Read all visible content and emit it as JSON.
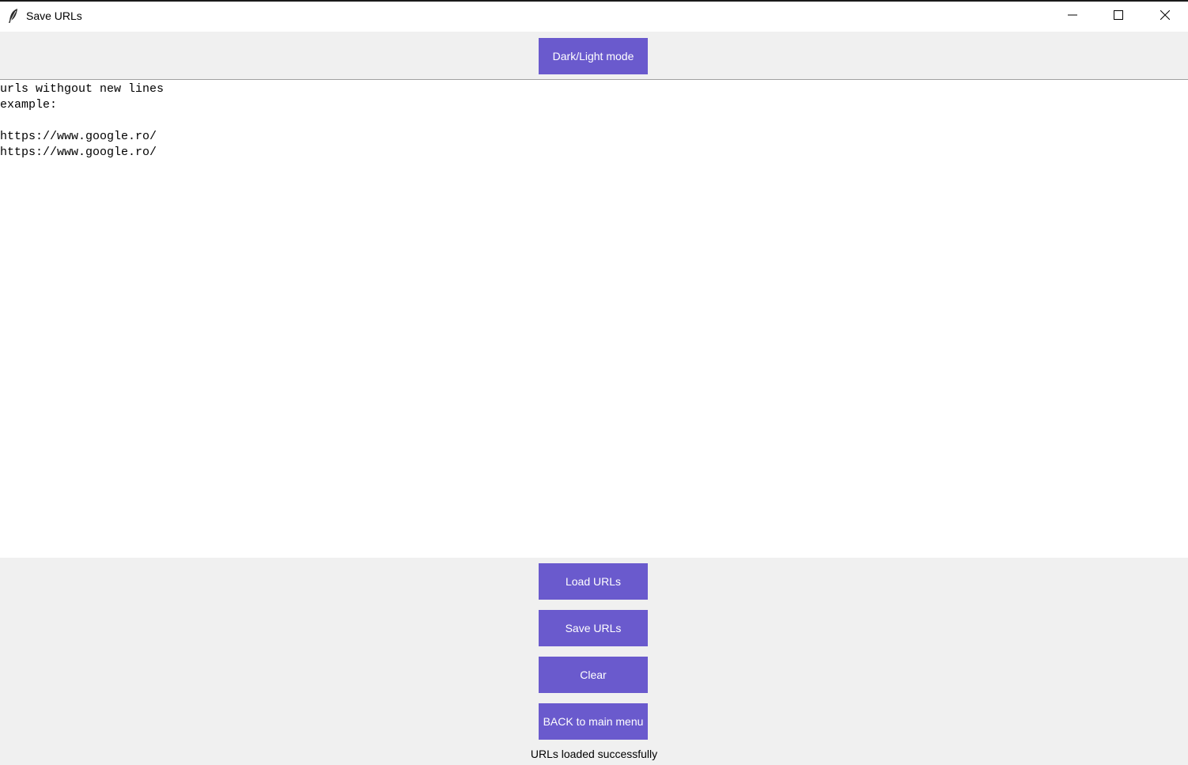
{
  "window": {
    "title": "Save URLs",
    "icon": "feather-icon"
  },
  "toolbar": {
    "mode_label": "Dark/Light mode"
  },
  "editor": {
    "content": "urls withgout new lines\nexample:\n\nhttps://www.google.ro/\nhttps://www.google.ro/"
  },
  "actions": {
    "load_label": "Load URLs",
    "save_label": "Save URLs",
    "clear_label": "Clear",
    "back_label": "BACK to main menu"
  },
  "status": {
    "message": "URLs loaded successfully"
  },
  "colors": {
    "button_bg": "#6a5acd",
    "button_text": "#ffffff",
    "panel_bg": "#f0f0f0",
    "editor_bg": "#ffffff"
  }
}
